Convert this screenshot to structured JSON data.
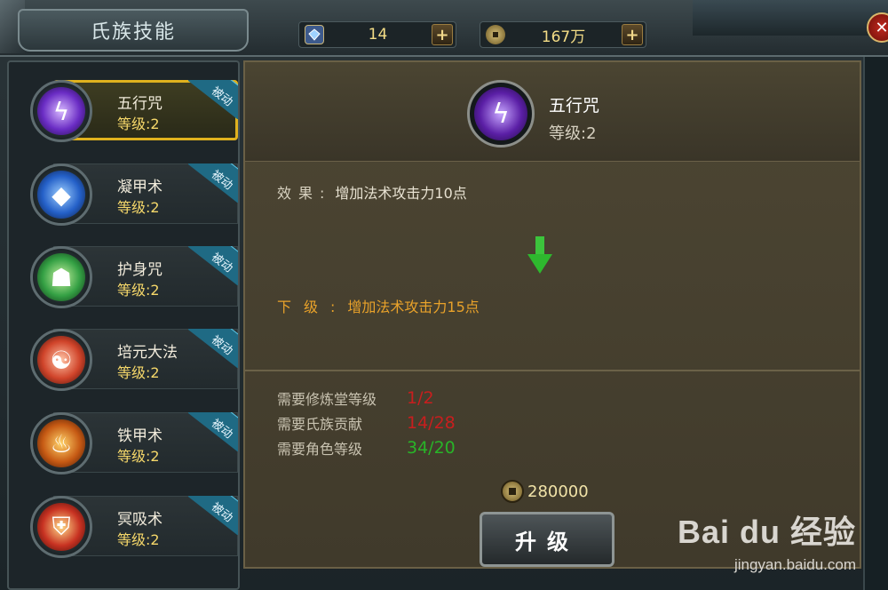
{
  "header": {
    "title": "氏族技能",
    "resources": [
      {
        "icon": "gem-icon",
        "value": "14"
      },
      {
        "icon": "coin-icon",
        "value": "167万"
      }
    ],
    "plus_label": "+"
  },
  "skills": [
    {
      "name": "五行咒",
      "level": "等级:2",
      "badge": "被动",
      "icon": "lightning-icon",
      "color": "#7a36d6",
      "selected": true
    },
    {
      "name": "凝甲术",
      "level": "等级:2",
      "badge": "被动",
      "icon": "crystal-shield-icon",
      "color": "#2a6ee0",
      "selected": false
    },
    {
      "name": "护身咒",
      "level": "等级:2",
      "badge": "被动",
      "icon": "aura-figure-icon",
      "color": "#3aa448",
      "selected": false
    },
    {
      "name": "培元大法",
      "level": "等级:2",
      "badge": "被动",
      "icon": "meditation-icon",
      "color": "#d0442a",
      "selected": false
    },
    {
      "name": "铁甲术",
      "level": "等级:2",
      "badge": "被动",
      "icon": "fire-demon-icon",
      "color": "#c46a18",
      "selected": false
    },
    {
      "name": "冥吸术",
      "level": "等级:2",
      "badge": "被动",
      "icon": "red-shield-icon",
      "color": "#c83222",
      "selected": false
    }
  ],
  "detail": {
    "name": "五行咒",
    "level": "等级:2",
    "effect_label": "效果:",
    "effect_text": "增加法术攻击力10点",
    "next_label": "下级:",
    "next_text": "增加法术攻击力15点",
    "requirements": [
      {
        "label": "需要修炼堂等级",
        "value": "1/2",
        "color": "#c81e1e"
      },
      {
        "label": "需要氏族贡献",
        "value": "14/28",
        "color": "#c81e1e"
      },
      {
        "label": "需要角色等级",
        "value": "34/20",
        "color": "#28b428"
      }
    ],
    "cost": "280000",
    "upgrade_label": "升级"
  },
  "watermark": {
    "brand": "Bai du 经验",
    "url": "jingyan.baidu.com"
  }
}
